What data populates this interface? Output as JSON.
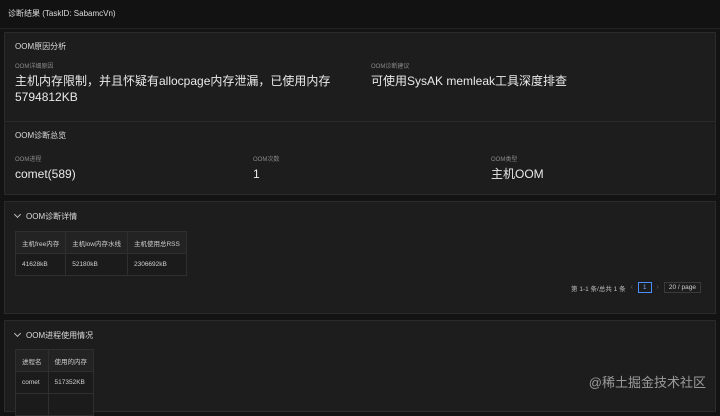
{
  "header": {
    "title": "诊断结果 (TaskID: SabamcVn)"
  },
  "cause_panel": {
    "title": "OOM原因分析",
    "detail_label": "OOM详细原因",
    "detail_value": "主机内存限制，并且怀疑有allocpage内存泄漏，已使用内存5794812KB",
    "suggestion_label": "OOM诊断建议",
    "suggestion_value": "可使用SysAK memleak工具深度排查"
  },
  "overview_panel": {
    "title": "OOM诊断总览",
    "process_label": "OOM进程",
    "process_value": "comet(589)",
    "count_label": "OOM次数",
    "count_value": "1",
    "type_label": "OOM类型",
    "type_value": "主机OOM"
  },
  "detail_panel": {
    "title": "OOM诊断详情",
    "columns": [
      "主机free内存",
      "主机low内存水线",
      "主机使用总RSS"
    ],
    "rows": [
      [
        "41628kB",
        "52180kB",
        "2306692kB"
      ]
    ],
    "pagination": {
      "summary": "第 1-1 条/总共 1 条",
      "prev": "‹",
      "current_page": "1",
      "next": "›",
      "page_size": "20 / page"
    }
  },
  "usage_panel": {
    "title": "OOM进程使用情况",
    "columns": [
      "进程名",
      "使用的内存"
    ],
    "rows": [
      [
        "comet",
        "517352KB"
      ],
      [
        "",
        ""
      ]
    ]
  },
  "watermark": "@稀土掘金技术社区"
}
